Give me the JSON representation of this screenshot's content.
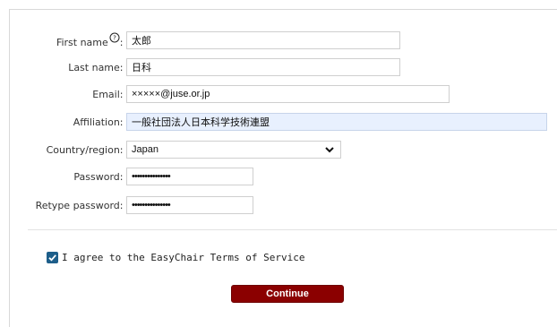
{
  "form": {
    "first_name": {
      "label": "First name",
      "help_icon": "help-circle-icon",
      "help_glyph": "?",
      "suffix": ":",
      "required": "*",
      "value": "太郎"
    },
    "last_name": {
      "label": "Last name:",
      "required": "*",
      "value": "日科"
    },
    "email": {
      "label": "Email:",
      "required": "*",
      "value": "×××××@juse.or.jp"
    },
    "affiliation": {
      "label": "Affiliation:",
      "required": "*",
      "value": "一般社団法人日本科学技術連盟"
    },
    "country": {
      "label": "Country/region:",
      "required": "*",
      "selected": "Japan"
    },
    "password": {
      "label": "Password:",
      "required": "*",
      "value": "•••••••••••••••"
    },
    "retype_password": {
      "label": "Retype password:",
      "required": "*",
      "value": "•••••••••••••••"
    }
  },
  "terms": {
    "checked": true,
    "label": "I agree to the EasyChair Terms of Service"
  },
  "continue_button": {
    "label": "Continue"
  },
  "colors": {
    "required": "#d93025",
    "button": "#8b0000",
    "checkbox": "#1d5e8a",
    "autofill": "#e8f0fe"
  }
}
